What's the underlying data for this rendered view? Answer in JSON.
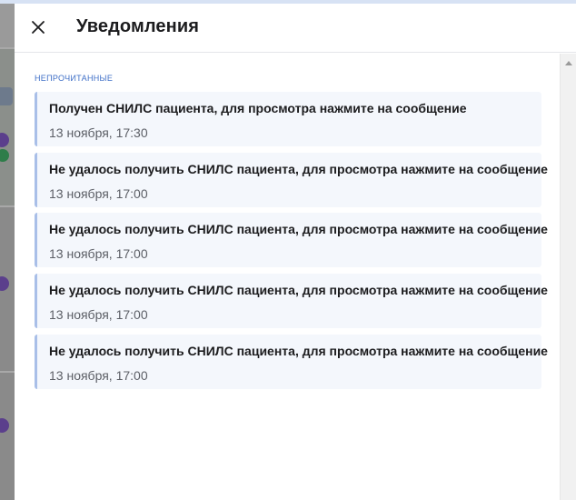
{
  "header": {
    "title": "Уведомления",
    "close_icon": "close-icon"
  },
  "section": {
    "label": "НЕПРОЧИТАННЫЕ"
  },
  "notifications": [
    {
      "message": "Получен СНИЛС пациента, для просмотра нажмите на сообщение",
      "time": "13 ноября, 17:30"
    },
    {
      "message": "Не удалось получить СНИЛС пациента, для просмотра нажмите на сообщение",
      "time": "13 ноября, 17:00"
    },
    {
      "message": "Не удалось получить СНИЛС пациента, для просмотра нажмите на сообщение",
      "time": "13 ноября, 17:00"
    },
    {
      "message": "Не удалось получить СНИЛС пациента, для просмотра нажмите на сообщение",
      "time": "13 ноября, 17:00"
    },
    {
      "message": "Не удалось получить СНИЛС пациента, для просмотра нажмите на сообщение",
      "time": "13 ноября, 17:00"
    }
  ],
  "colors": {
    "accent": "#3f6fc7",
    "card_background": "#f4f7fc",
    "card_border": "#a9bfe8"
  }
}
